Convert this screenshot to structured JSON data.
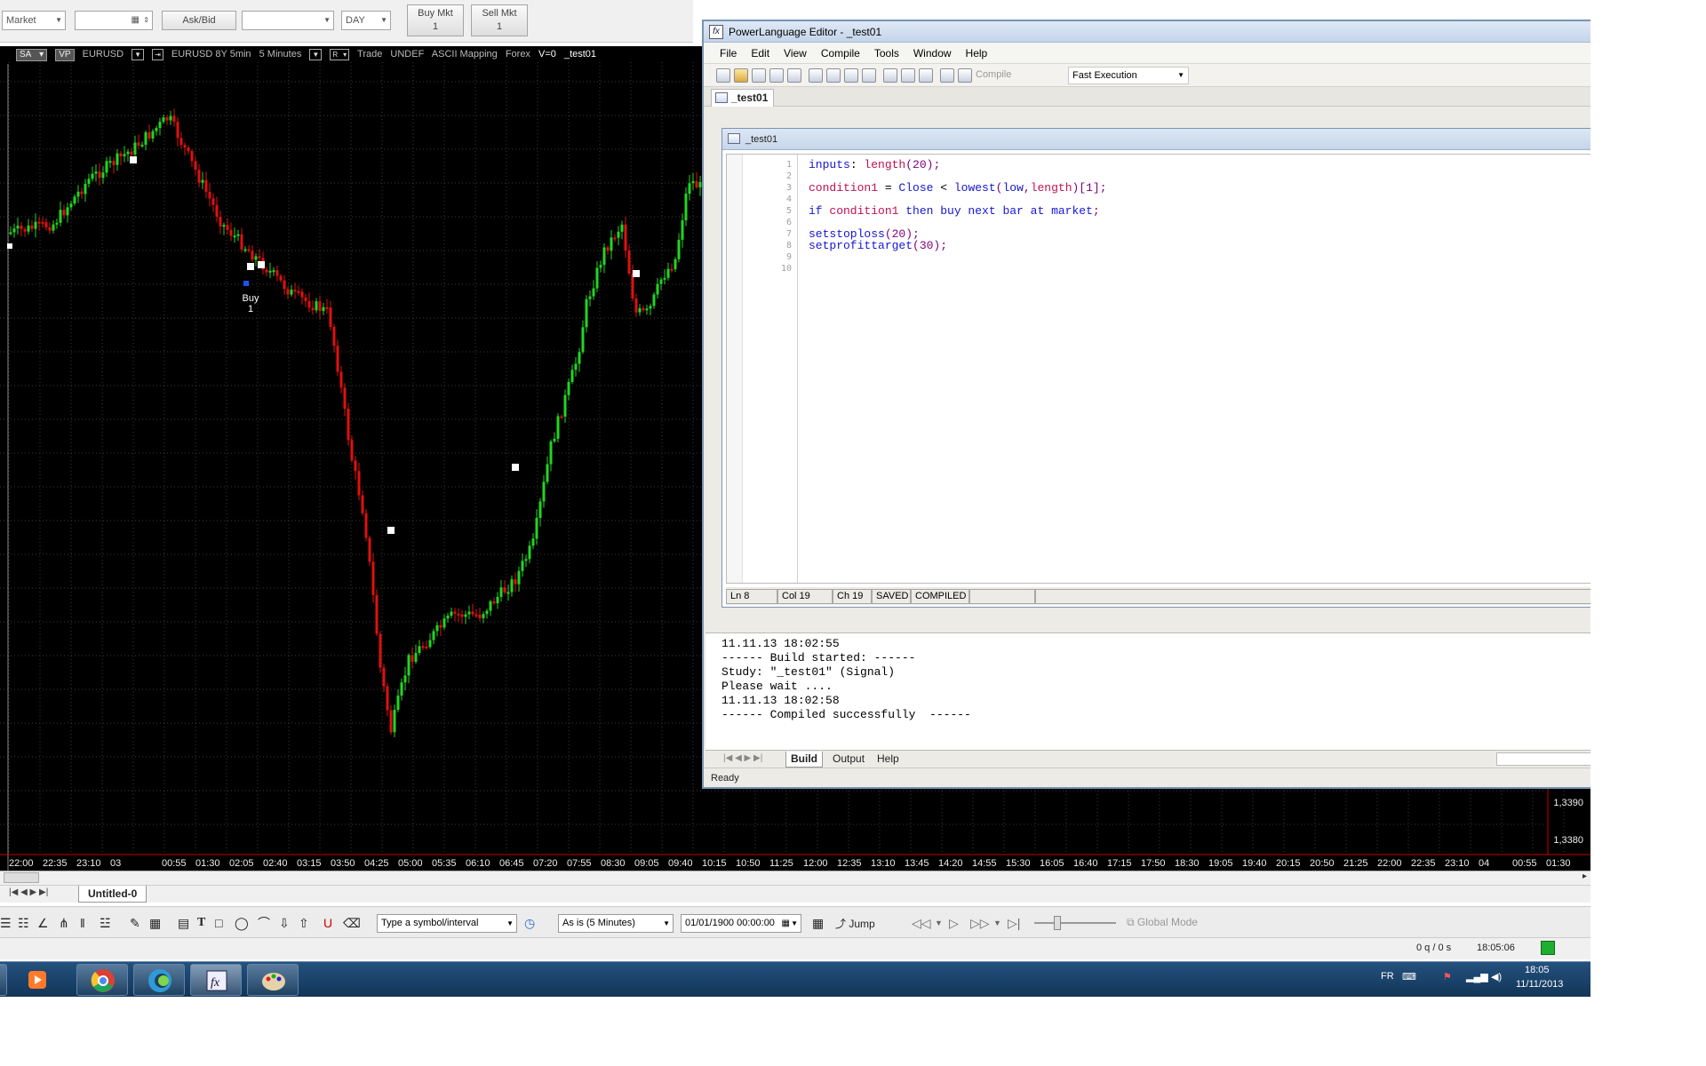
{
  "topbar": {
    "order_type": "Market",
    "ask_bid": "Ask/Bid",
    "duration": "DAY",
    "buy_mkt_label": "Buy Mkt",
    "buy_mkt_qty": "1",
    "sell_mkt_label": "Sell Mkt",
    "sell_mkt_qty": "1"
  },
  "chart": {
    "tag_sa": "SA",
    "tag_vp": "VP",
    "symbol": "EURUSD",
    "description": "EURUSD 8Y 5min",
    "interval": "5 Minutes",
    "tag_r": "R",
    "data_mode": "Trade",
    "undef": "UNDEF",
    "mapping": "ASCII Mapping",
    "category": "Forex",
    "volume": "V=0",
    "study": "_test01",
    "buy_label": "Buy",
    "buy_qty": "1",
    "price_labels": [
      "1,3390",
      "1,3380"
    ],
    "time_labels": [
      "22:00",
      "22:35",
      "23:10",
      "03",
      "00:55",
      "01:30",
      "02:05",
      "02:40",
      "03:15",
      "03:50",
      "04:25",
      "05:00",
      "05:35",
      "06:10",
      "06:45",
      "07:20",
      "07:55",
      "08:30",
      "09:05",
      "09:40",
      "10:15",
      "10:50",
      "11:25",
      "12:00",
      "12:35",
      "13:10",
      "13:45",
      "14:20",
      "14:55",
      "15:30",
      "16:05",
      "16:40",
      "17:15",
      "17:50",
      "18:30",
      "19:05",
      "19:40",
      "20:15",
      "20:50",
      "21:25",
      "22:00",
      "22:35",
      "23:10",
      "04",
      "00:55",
      "01:30"
    ],
    "colors": {
      "up": "#22d622",
      "down": "#e01010",
      "background": "#000000",
      "grid": "#3a3a3a"
    }
  },
  "editor": {
    "title": "PowerLanguage Editor - _test01",
    "menu": [
      "File",
      "Edit",
      "View",
      "Compile",
      "Tools",
      "Window",
      "Help"
    ],
    "compile_label": "Compile",
    "mode": "Fast Execution",
    "tab": "_test01",
    "doc_title": "_test01",
    "line_numbers": [
      "1",
      "2",
      "3",
      "4",
      "5",
      "6",
      "7",
      "8",
      "9",
      "10"
    ],
    "code": {
      "l1_kw": "inputs",
      "l1_colon": ": ",
      "l1_ident": "length",
      "l1_rest": "(20);",
      "l3_ident": "condition1",
      "l3_eq": " = ",
      "l3_close": "Close",
      "l3_lt": " < ",
      "l3_lowest": "lowest",
      "l3_paren": "(",
      "l3_low": "low",
      "l3_comma": ",",
      "l3_length": "length",
      "l3_rest": ")[1];",
      "l5_if": "if ",
      "l5_cond": "condition1",
      "l5_then": " then buy next bar at ",
      "l5_market": "market",
      "l5_semi": ";",
      "l7_fn": "setstoploss",
      "l7_rest": "(20);",
      "l8_fn": "setprofittarget",
      "l8_rest": "(30);"
    },
    "status": {
      "ln": "Ln 8",
      "col": "Col 19",
      "ch": "Ch 19",
      "saved": "SAVED",
      "compiled": "COMPILED"
    },
    "output_lines": [
      "11.11.13 18:02:55",
      "------ Build started: ------",
      "Study: \"_test01\" (Signal)",
      "Please wait ....",
      "11.11.13 18:02:58",
      "------ Compiled successfully  ------"
    ],
    "output_tabs": [
      "Build",
      "Output",
      "Help"
    ],
    "ready": "Ready"
  },
  "sheet": {
    "tab": "Untitled-0"
  },
  "drawbar": {
    "symbol_placeholder": "Type a symbol/interval",
    "resolution": "As is (5 Minutes)",
    "date": "01/01/1900 00:00:00",
    "jump": "Jump",
    "global_mode": "Global Mode"
  },
  "statusbar": {
    "queue": "0 q / 0 s",
    "clock": "18:05:06"
  },
  "taskbar": {
    "lang": "FR",
    "time": "18:05",
    "date": "11/11/2013"
  }
}
